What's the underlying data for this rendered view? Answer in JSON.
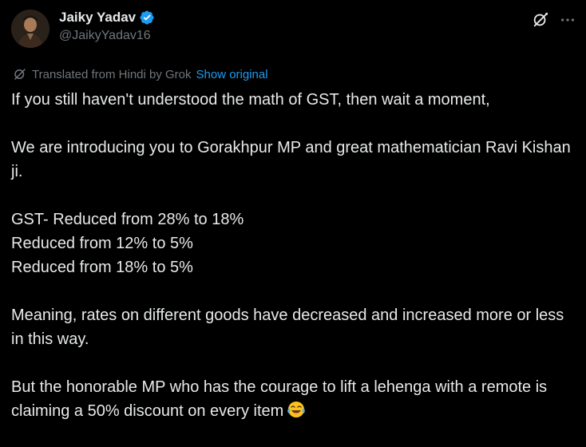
{
  "post": {
    "author": {
      "display_name": "Jaiky Yadav",
      "handle": "@JaikyYadav16",
      "verified": true,
      "avatar_icon": "avatar-photo"
    },
    "actions": {
      "grok_icon": "grok-icon",
      "more_icon": "more-horizontal-icon"
    },
    "translation": {
      "notice": "Translated from Hindi by Grok",
      "show_original": "Show original"
    },
    "body": {
      "p1": "If you still haven't understood the math of GST, then wait a moment,",
      "p2": "We are introducing you to Gorakhpur MP and great mathematician Ravi Kishan ji.",
      "p3_lines": [
        "GST- Reduced from 28% to 18%",
        "Reduced from 12% to 5%",
        "Reduced from 18% to 5%"
      ],
      "p4": "Meaning, rates on different goods have decreased and increased more or less in this way.",
      "p5": "But the honorable MP who has the courage to lift a lehenga with a remote is claiming a 50% discount on every item",
      "p5_emoji": "😂"
    }
  },
  "colors": {
    "background": "#000000",
    "text": "#e7e9ea",
    "muted": "#71767b",
    "link": "#1d9bf0",
    "verified": "#1d9bf0"
  }
}
